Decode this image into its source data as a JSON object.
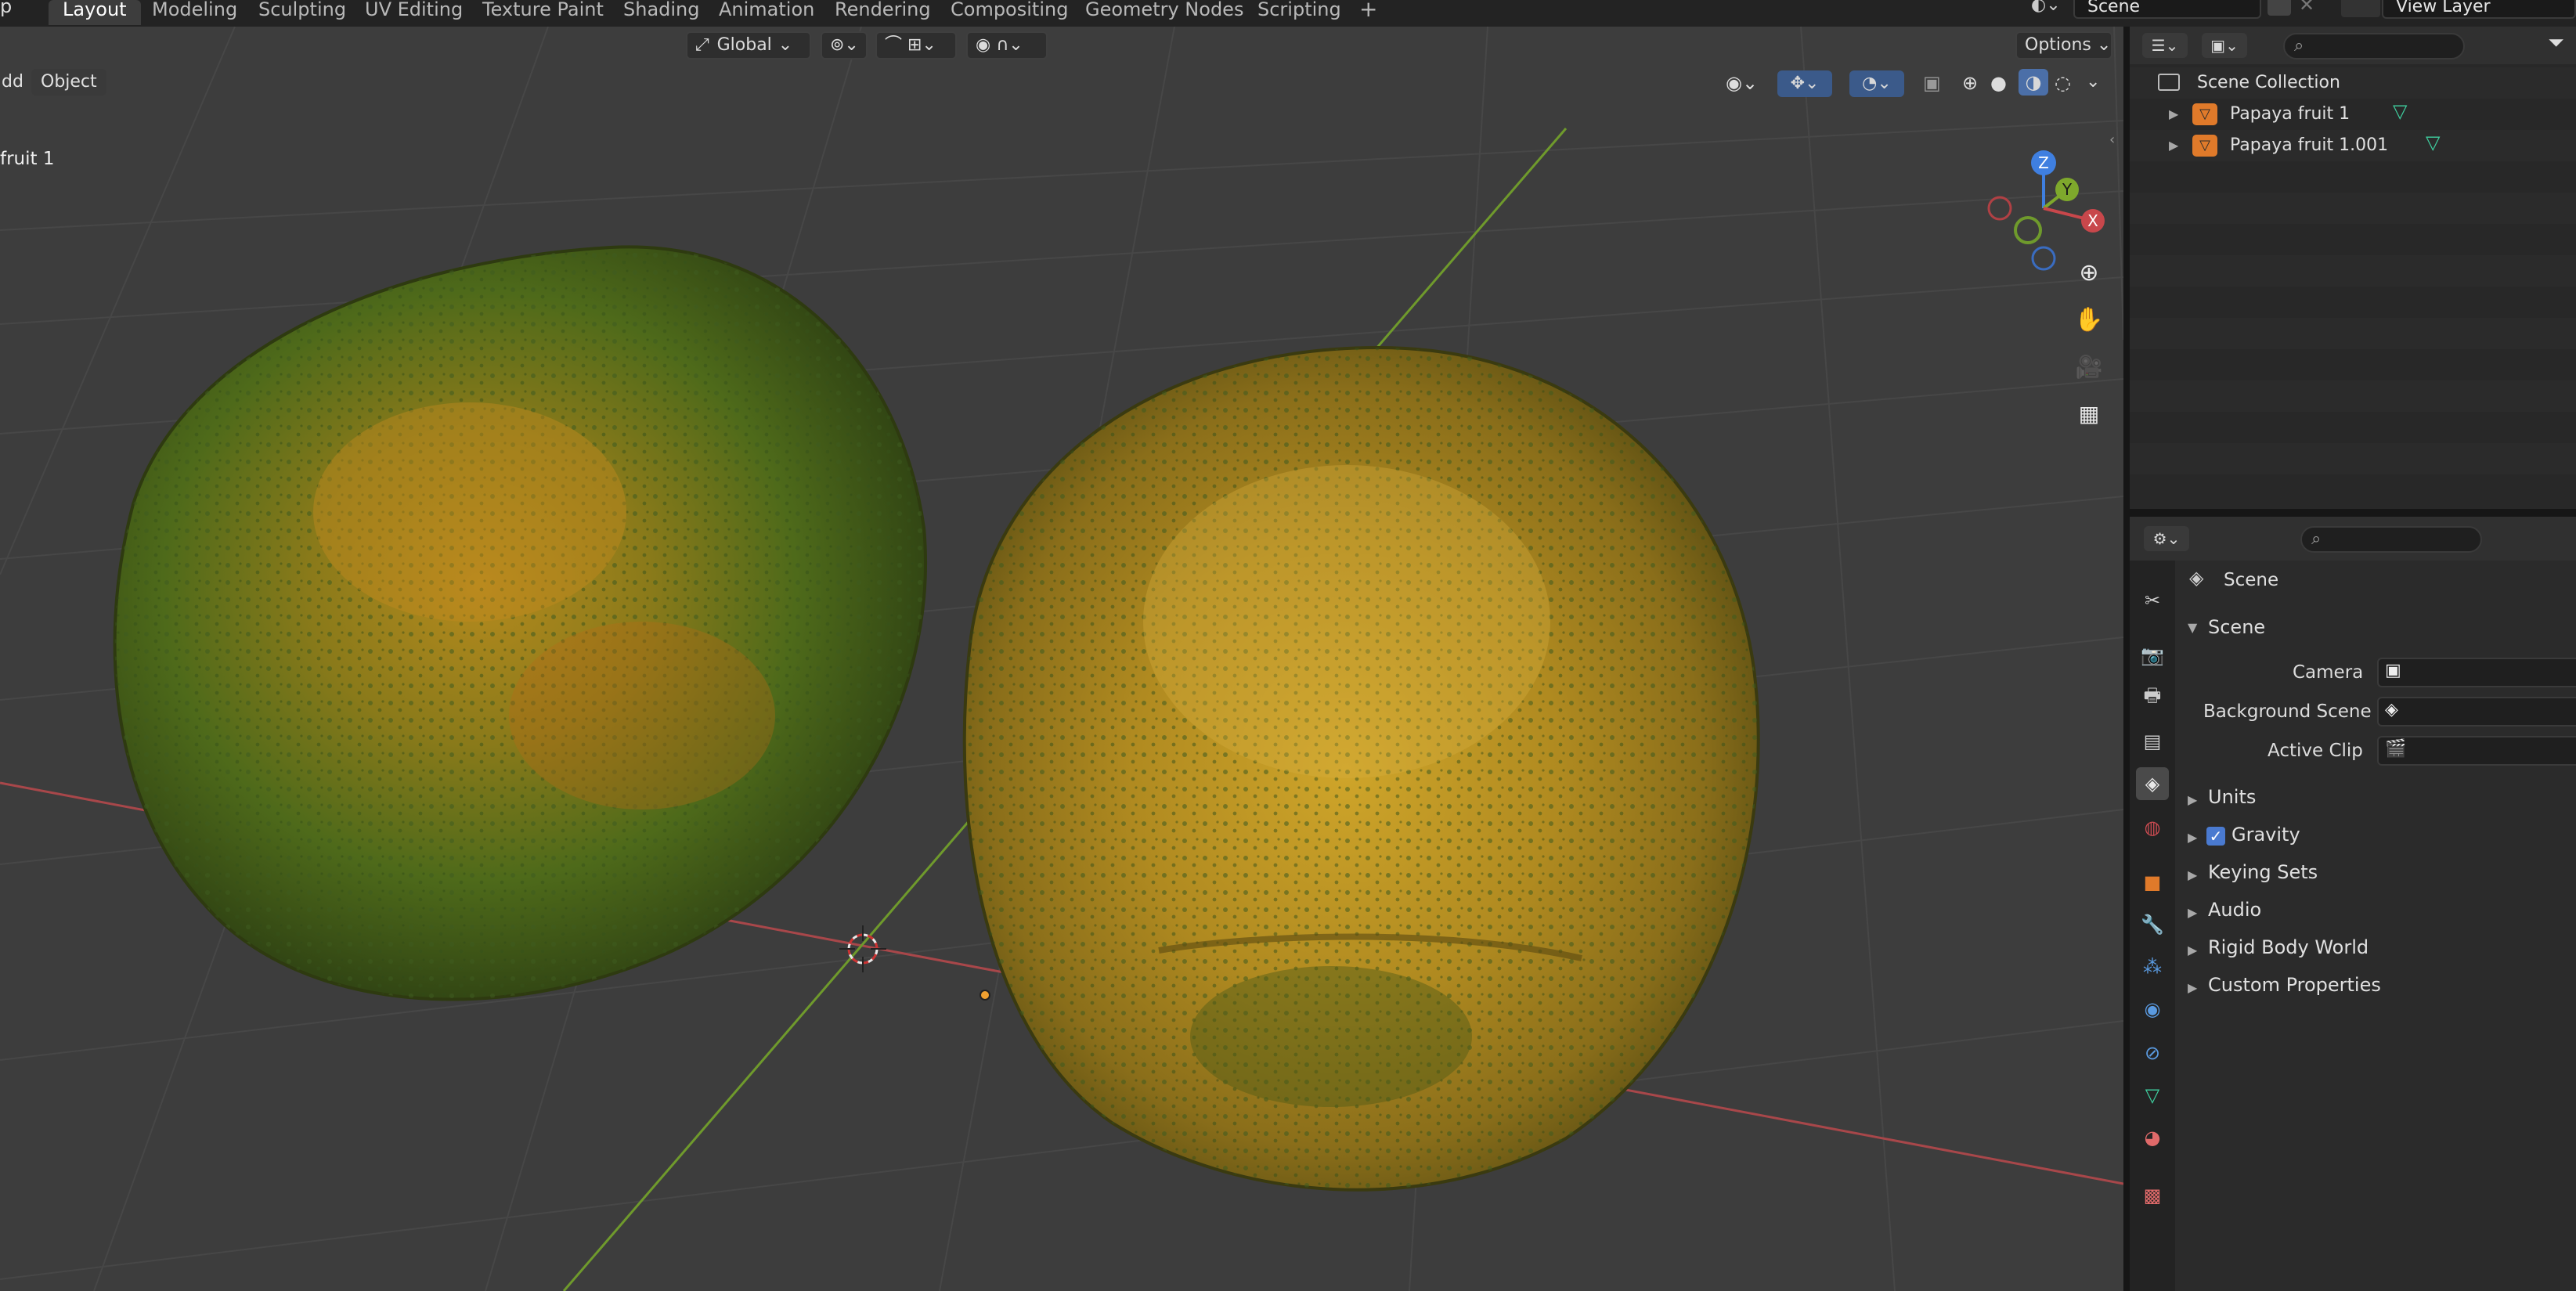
{
  "app": {
    "file_menu_fragment": "p"
  },
  "workspaces": {
    "tabs": [
      "Layout",
      "Modeling",
      "Sculpting",
      "UV Editing",
      "Texture Paint",
      "Shading",
      "Animation",
      "Rendering",
      "Compositing",
      "Geometry Nodes",
      "Scripting"
    ],
    "active": "Layout",
    "add_label": "+"
  },
  "scene_selector": {
    "value": "Scene"
  },
  "view_layer_selector": {
    "value": "View Layer"
  },
  "viewport": {
    "menu_add": "dd",
    "menu_object": "Object",
    "transform_orientation": "Global",
    "options_label": "Options",
    "object_info": "fruit 1",
    "gizmo_axes": {
      "z": "Z",
      "y": "Y",
      "x": "X"
    },
    "colors": {
      "x_axis": "#c8474b",
      "y_axis": "#7ea82c",
      "z_axis": "#3f7fe0",
      "grid_bg": "#3c3c3c"
    }
  },
  "outliner": {
    "search_placeholder": "",
    "root": "Scene Collection",
    "items": [
      {
        "name": "Papaya fruit 1",
        "icon": "mesh-object-icon"
      },
      {
        "name": "Papaya fruit 1.001",
        "icon": "mesh-object-icon"
      }
    ]
  },
  "properties": {
    "context_title": "Scene",
    "panel_title": "Scene",
    "fields": [
      {
        "label": "Camera",
        "icon": "camera-object-icon"
      },
      {
        "label": "Background Scene",
        "icon": "scene-icon"
      },
      {
        "label": "Active Clip",
        "icon": "movie-clip-icon"
      }
    ],
    "collapsed_panels": [
      "Units",
      "Gravity",
      "Keying Sets",
      "Audio",
      "Rigid Body World",
      "Custom Properties"
    ],
    "gravity_checked": true,
    "tabs": [
      "tool-icon",
      "render-icon",
      "output-icon",
      "view-layer-icon",
      "scene-icon",
      "world-icon",
      "object-icon",
      "modifier-icon",
      "particles-icon",
      "physics-icon",
      "constraints-icon",
      "data-icon",
      "material-icon",
      "texture-icon"
    ]
  }
}
